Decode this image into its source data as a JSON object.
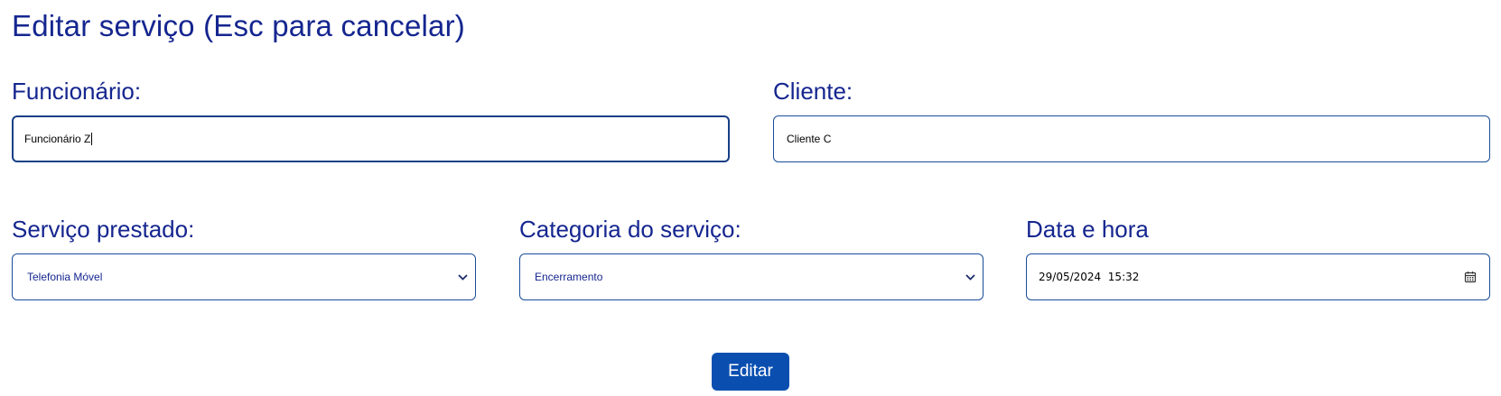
{
  "title": "Editar serviço (Esc para cancelar)",
  "form": {
    "employee": {
      "label": "Funcionário:",
      "value": "Funcionário Z"
    },
    "client": {
      "label": "Cliente:",
      "value": "Cliente C"
    },
    "service": {
      "label": "Serviço prestado:",
      "value": "Telefonia Móvel"
    },
    "category": {
      "label": "Categoria do serviço:",
      "value": "Encerramento"
    },
    "datetime": {
      "label": "Data e hora",
      "value": "29/05/2024  15:32"
    }
  },
  "submit_label": "Editar",
  "colors": {
    "text_primary": "#15268f",
    "border": "#1a4d9a",
    "button": "#0a4fb0"
  },
  "icons": {
    "select_arrow": "chevron-down-icon",
    "date_picker": "calendar-icon"
  }
}
